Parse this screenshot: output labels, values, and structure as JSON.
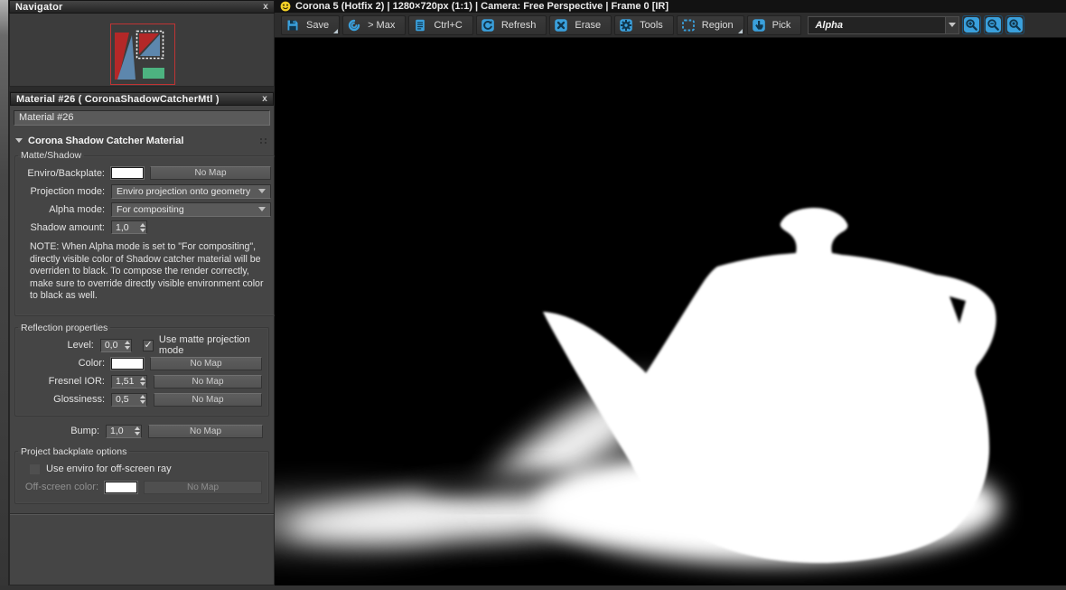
{
  "colors": {
    "accent_blue": "#3aa0dc",
    "panel_gray": "#454545",
    "render_bg": "#000000",
    "alpha_white": "#ffffff",
    "node_red": "#b42828",
    "node_blue": "#5d87ad",
    "node_green": "#4db380",
    "smiley_yellow": "#f2cf27"
  },
  "icons": {
    "window_close": "x",
    "checkmark": "✓"
  },
  "vfb": {
    "title": "Corona 5 (Hotfix 2) | 1280×720px (1:1) | Camera: Free Perspective | Frame 0 [IR]",
    "toolbar": {
      "buttons": [
        {
          "label": "Save"
        },
        {
          "label": "> Max"
        },
        {
          "label": "Ctrl+C"
        },
        {
          "label": "Refresh"
        },
        {
          "label": "Erase"
        },
        {
          "label": "Tools"
        },
        {
          "label": "Region"
        },
        {
          "label": "Pick"
        }
      ],
      "channel": {
        "value": "Alpha"
      }
    }
  },
  "navigator": {
    "title": "Navigator"
  },
  "panel": {
    "title": "Material #26  ( CoronaShadowCatcherMtl )",
    "name_field": "Material #26",
    "rollout_title": "Corona Shadow Catcher Material",
    "matte": {
      "legend": "Matte/Shadow",
      "enviro_label": "Enviro/Backplate:",
      "enviro_map": "No Map",
      "projection_label": "Projection mode:",
      "projection_value": "Enviro projection onto geometry",
      "alpha_label": "Alpha mode:",
      "alpha_value": "For compositing",
      "shadow_label": "Shadow amount:",
      "shadow_value": "1,0",
      "note": "NOTE: When Alpha mode is set to \"For compositing\", directly visible color of Shadow catcher material will be overriden to black. To compose the render correctly, make sure to override directly visible environment color to black as well."
    },
    "reflection": {
      "legend": "Reflection properties",
      "level_label": "Level:",
      "level_value": "0,0",
      "matte_check_label": "Use matte projection mode",
      "color_label": "Color:",
      "color_map": "No Map",
      "ior_label": "Fresnel IOR:",
      "ior_value": "1,51",
      "ior_map": "No Map",
      "gloss_label": "Glossiness:",
      "gloss_value": "0,5",
      "gloss_map": "No Map"
    },
    "bump": {
      "label": "Bump:",
      "value": "1,0",
      "map": "No Map"
    },
    "backplate": {
      "legend": "Project backplate options",
      "check_label": "Use enviro for off-screen ray",
      "color_label": "Off-screen color:",
      "map": "No Map"
    }
  }
}
